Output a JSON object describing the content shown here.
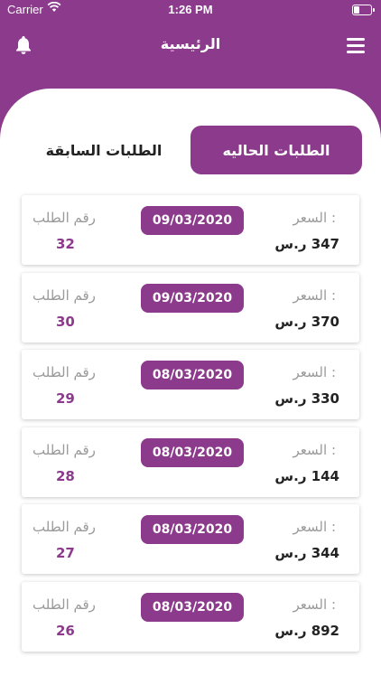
{
  "status_bar": {
    "carrier": "Carrier",
    "time": "1:26 PM"
  },
  "header": {
    "title": "الرئيسية"
  },
  "tabs": {
    "current": "الطلبات الحاليه",
    "previous": "الطلبات السابقة"
  },
  "labels": {
    "price": "السعر :",
    "order_number": "رقم الطلب",
    "currency": "ر.س"
  },
  "colors": {
    "brand": "#8B3A8C"
  },
  "orders": [
    {
      "price": "347 ر.س",
      "date": "09/03/2020",
      "number": "32"
    },
    {
      "price": "370 ر.س",
      "date": "09/03/2020",
      "number": "30"
    },
    {
      "price": "330 ر.س",
      "date": "08/03/2020",
      "number": "29"
    },
    {
      "price": "144 ر.س",
      "date": "08/03/2020",
      "number": "28"
    },
    {
      "price": "344 ر.س",
      "date": "08/03/2020",
      "number": "27"
    },
    {
      "price": "892 ر.س",
      "date": "08/03/2020",
      "number": "26"
    }
  ]
}
